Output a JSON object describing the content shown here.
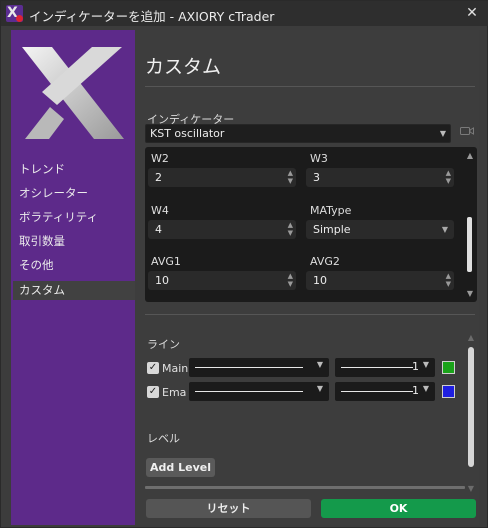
{
  "window": {
    "title": "インディケーターを追加 - AXIORY cTrader",
    "close_icon": "close-icon"
  },
  "sidebar": {
    "items": [
      {
        "label": "トレンド",
        "active": false
      },
      {
        "label": "オシレーター",
        "active": false
      },
      {
        "label": "ボラティリティ",
        "active": false
      },
      {
        "label": "取引数量",
        "active": false
      },
      {
        "label": "その他",
        "active": false
      },
      {
        "label": "カスタム",
        "active": true
      }
    ]
  },
  "main": {
    "title": "カスタム",
    "indicator_label": "インディケーター",
    "indicator_value": "KST oscillator",
    "params": [
      {
        "label": "W2",
        "value": "2",
        "kind": "number"
      },
      {
        "label": "W3",
        "value": "3",
        "kind": "number"
      },
      {
        "label": "W4",
        "value": "4",
        "kind": "number"
      },
      {
        "label": "MAType",
        "value": "Simple",
        "kind": "select"
      },
      {
        "label": "AVG1",
        "value": "10",
        "kind": "number"
      },
      {
        "label": "AVG2",
        "value": "10",
        "kind": "number"
      }
    ],
    "lines_label": "ライン",
    "lines": [
      {
        "name": "Main",
        "checked": true,
        "thickness": "1",
        "color": "#1aa31a"
      },
      {
        "name": "Ema",
        "checked": true,
        "thickness": "1",
        "color": "#1f1fe0"
      }
    ],
    "levels_label": "レベル",
    "add_level_label": "Add Level"
  },
  "footer": {
    "reset_label": "リセット",
    "ok_label": "OK"
  },
  "colors": {
    "sidebar": "#5d2a8a",
    "ok": "#149a4b",
    "accent_green": "#1aa31a",
    "accent_blue": "#1f1fe0"
  }
}
